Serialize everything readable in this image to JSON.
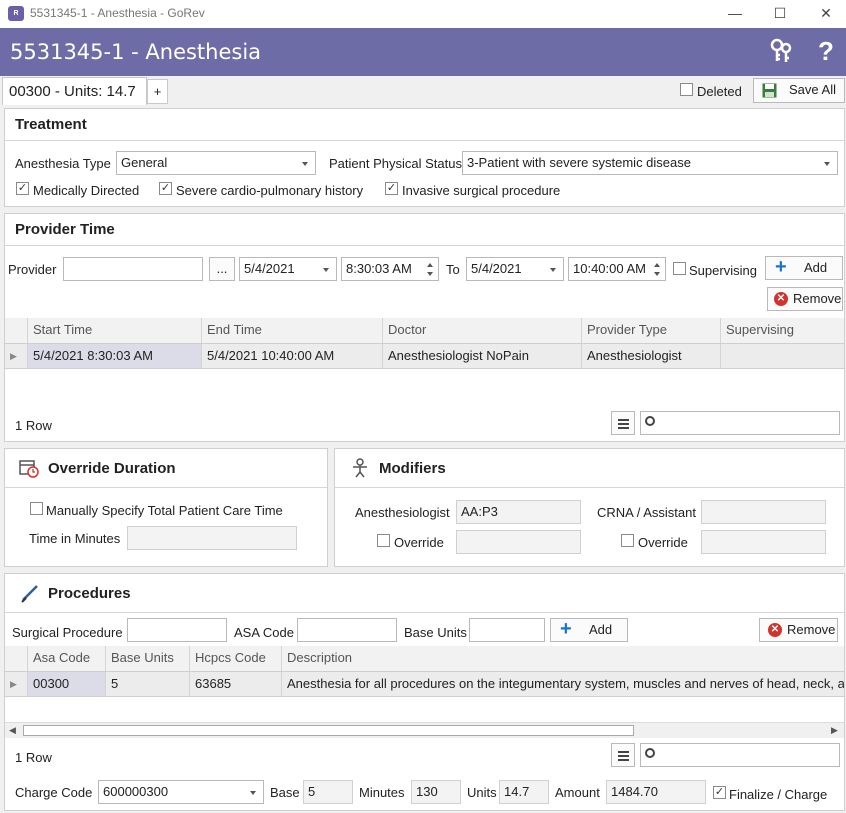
{
  "window": {
    "title": "5531345-1 - Anesthesia - GoRev",
    "app_icon_text": "GoRev"
  },
  "header": {
    "title": "5531345-1 - Anesthesia"
  },
  "tabs": {
    "active_label": "00300 - Units: 14.7",
    "add_label": "+"
  },
  "toolbar": {
    "deleted_label": "Deleted",
    "deleted_checked": false,
    "save_all_label": "Save All"
  },
  "treatment": {
    "heading": "Treatment",
    "anesthesia_type_label": "Anesthesia Type",
    "anesthesia_type_value": "General",
    "physical_status_label": "Patient Physical Status",
    "physical_status_value": "3-Patient with severe systemic disease",
    "checks": [
      {
        "label": "Medically Directed",
        "checked": true
      },
      {
        "label": "Severe cardio-pulmonary history",
        "checked": true
      },
      {
        "label": "Invasive surgical procedure",
        "checked": true
      }
    ]
  },
  "provider_time": {
    "heading": "Provider Time",
    "provider_label": "Provider",
    "provider_value": "",
    "browse_label": "...",
    "start_date": "5/4/2021",
    "start_time": "8:30:03 AM",
    "to_label": "To",
    "end_date": "5/4/2021",
    "end_time": "10:40:00 AM",
    "supervising_label": "Supervising",
    "add_label": "Add",
    "remove_label": "Remove",
    "columns": [
      "Start Time",
      "End Time",
      "Doctor",
      "Provider Type",
      "Supervising"
    ],
    "rows": [
      {
        "start": "5/4/2021 8:30:03 AM",
        "end": "5/4/2021 10:40:00 AM",
        "doctor": "Anesthesiologist NoPain",
        "type": "Anesthesiologist",
        "supervising": ""
      }
    ],
    "row_count": "1 Row"
  },
  "override": {
    "heading": "Override Duration",
    "manual_label": "Manually Specify Total Patient Care Time",
    "time_label": "Time in Minutes",
    "time_value": ""
  },
  "modifiers": {
    "heading": "Modifiers",
    "anesthesiologist_label": "Anesthesiologist",
    "anesthesiologist_value": "AA:P3",
    "crna_label": "CRNA / Assistant",
    "crna_value": "",
    "override_label": "Override"
  },
  "procedures": {
    "heading": "Procedures",
    "surgical_label": "Surgical Procedure",
    "asa_label": "ASA Code",
    "base_units_label": "Base Units",
    "add_label": "Add",
    "remove_label": "Remove",
    "columns": [
      "Asa Code",
      "Base Units",
      "Hcpcs Code",
      "Description"
    ],
    "rows": [
      {
        "asa": "00300",
        "base": "5",
        "hcpcs": "63685",
        "description": "Anesthesia for all procedures on the integumentary system, muscles and nerves of head, neck, a"
      }
    ],
    "row_count": "1 Row"
  },
  "charge": {
    "charge_code_label": "Charge Code",
    "charge_code_value": "600000300",
    "base_label": "Base",
    "base_value": "5",
    "minutes_label": "Minutes",
    "minutes_value": "130",
    "units_label": "Units",
    "units_value": "14.7",
    "amount_label": "Amount",
    "amount_value": "1484.70",
    "finalize_label": "Finalize / Charge",
    "finalize_checked": true
  }
}
